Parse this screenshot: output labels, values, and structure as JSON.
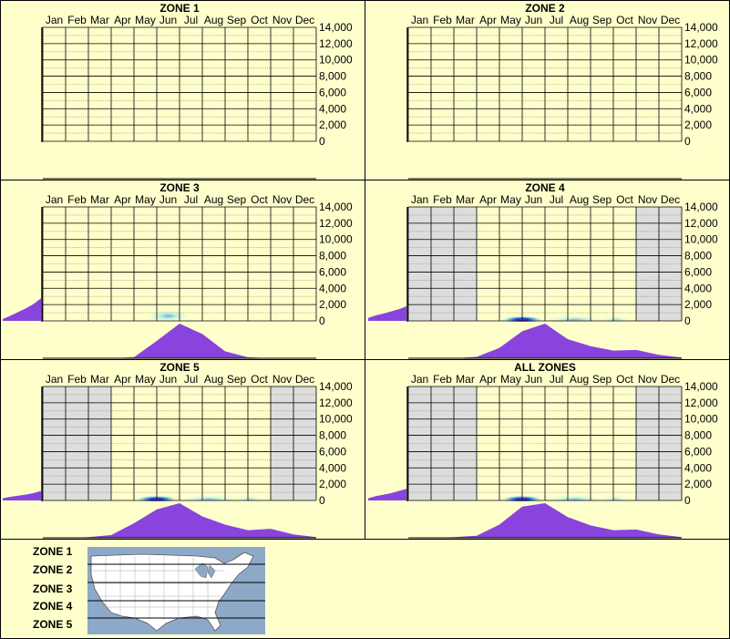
{
  "months": [
    "Jan",
    "Feb",
    "Mar",
    "Apr",
    "May",
    "Jun",
    "Jul",
    "Aug",
    "Sep",
    "Oct",
    "Nov",
    "Dec"
  ],
  "y_ticks": [
    "14,000",
    "12,000",
    "10,000",
    "8,000",
    "6,000",
    "4,000",
    "2,000",
    "0"
  ],
  "colors": {
    "background": "#ffffcc",
    "grid": "#000000",
    "minor_grid": "#888888",
    "off_season": "#dddddd",
    "profile": "#8844dd",
    "heat_center": "#ff2266",
    "heat_core": "#2222cc",
    "heat_mid": "#3399dd",
    "heat_edge": "#aaeeee"
  },
  "chart_data": [
    {
      "type": "heatmap",
      "title": "ZONE 1",
      "x": [
        "Jan",
        "Feb",
        "Mar",
        "Apr",
        "May",
        "Jun",
        "Jul",
        "Aug",
        "Sep",
        "Oct",
        "Nov",
        "Dec"
      ],
      "ylim": [
        0,
        14000
      ],
      "shaded_months": [],
      "heat": [],
      "monthly_profile": [],
      "elevation_profile": []
    },
    {
      "type": "heatmap",
      "title": "ZONE 2",
      "x": [
        "Jan",
        "Feb",
        "Mar",
        "Apr",
        "May",
        "Jun",
        "Jul",
        "Aug",
        "Sep",
        "Oct",
        "Nov",
        "Dec"
      ],
      "ylim": [
        0,
        14000
      ],
      "shaded_months": [],
      "heat": [],
      "monthly_profile": [],
      "elevation_profile": []
    },
    {
      "type": "heatmap",
      "title": "ZONE 3",
      "x": [
        "Jan",
        "Feb",
        "Mar",
        "Apr",
        "May",
        "Jun",
        "Jul",
        "Aug",
        "Sep",
        "Oct",
        "Nov",
        "Dec"
      ],
      "ylim": [
        0,
        14000
      ],
      "shaded_months": [],
      "heat": [
        {
          "month": 6.0,
          "spread": 0.9,
          "elev": 600,
          "elev_spread": 700,
          "intensity": 0.35
        }
      ],
      "monthly_profile": [
        0,
        0,
        0,
        0,
        0.03,
        0.5,
        1.0,
        0.7,
        0.2,
        0.03,
        0,
        0,
        0
      ],
      "elevation_profile": [
        0.05,
        0.14,
        0.24,
        0.34,
        0.46,
        0.62
      ]
    },
    {
      "type": "heatmap",
      "title": "ZONE 4",
      "x": [
        "Jan",
        "Feb",
        "Mar",
        "Apr",
        "May",
        "Jun",
        "Jul",
        "Aug",
        "Sep",
        "Oct",
        "Nov",
        "Dec"
      ],
      "ylim": [
        0,
        14000
      ],
      "shaded_months": [
        "Jan",
        "Feb",
        "Mar",
        "Nov",
        "Dec"
      ],
      "heat": [
        {
          "month": 5.5,
          "spread": 0.9,
          "elev": 150,
          "elev_spread": 250,
          "intensity": 1.0
        },
        {
          "month": 7.8,
          "spread": 1.2,
          "elev": 150,
          "elev_spread": 220,
          "intensity": 0.3
        },
        {
          "month": 9.6,
          "spread": 0.6,
          "elev": 150,
          "elev_spread": 220,
          "intensity": 0.18
        }
      ],
      "monthly_profile": [
        0,
        0,
        0,
        0.04,
        0.3,
        0.78,
        1.0,
        0.55,
        0.35,
        0.22,
        0.24,
        0.1,
        0.02
      ],
      "elevation_profile": [
        0.08,
        0.15,
        0.2,
        0.26,
        0.32,
        0.4
      ]
    },
    {
      "type": "heatmap",
      "title": "ZONE 5",
      "x": [
        "Jan",
        "Feb",
        "Mar",
        "Apr",
        "May",
        "Jun",
        "Jul",
        "Aug",
        "Sep",
        "Oct",
        "Nov",
        "Dec"
      ],
      "ylim": [
        0,
        14000
      ],
      "shaded_months": [
        "Jan",
        "Feb",
        "Mar",
        "Nov",
        "Dec"
      ],
      "heat": [
        {
          "month": 5.5,
          "spread": 0.9,
          "elev": 150,
          "elev_spread": 250,
          "intensity": 1.0
        },
        {
          "month": 7.8,
          "spread": 1.2,
          "elev": 150,
          "elev_spread": 220,
          "intensity": 0.3
        },
        {
          "month": 9.6,
          "spread": 0.6,
          "elev": 150,
          "elev_spread": 220,
          "intensity": 0.18
        }
      ],
      "monthly_profile": [
        0,
        0,
        0.02,
        0.08,
        0.42,
        0.82,
        1.0,
        0.62,
        0.38,
        0.22,
        0.26,
        0.1,
        0.02
      ],
      "elevation_profile": [
        0.06,
        0.1,
        0.13,
        0.16,
        0.2,
        0.26
      ]
    },
    {
      "type": "heatmap",
      "title": "ALL ZONES",
      "x": [
        "Jan",
        "Feb",
        "Mar",
        "Apr",
        "May",
        "Jun",
        "Jul",
        "Aug",
        "Sep",
        "Oct",
        "Nov",
        "Dec"
      ],
      "ylim": [
        0,
        14000
      ],
      "shaded_months": [
        "Jan",
        "Feb",
        "Mar",
        "Nov",
        "Dec"
      ],
      "heat": [
        {
          "month": 5.5,
          "spread": 0.9,
          "elev": 150,
          "elev_spread": 250,
          "intensity": 1.0
        },
        {
          "month": 7.8,
          "spread": 1.2,
          "elev": 150,
          "elev_spread": 220,
          "intensity": 0.3
        },
        {
          "month": 9.6,
          "spread": 0.6,
          "elev": 150,
          "elev_spread": 220,
          "intensity": 0.18
        }
      ],
      "monthly_profile": [
        0,
        0,
        0.02,
        0.06,
        0.38,
        0.9,
        1.0,
        0.6,
        0.36,
        0.22,
        0.24,
        0.1,
        0.02
      ],
      "elevation_profile": [
        0.06,
        0.12,
        0.16,
        0.2,
        0.26,
        0.32
      ]
    }
  ],
  "legend": {
    "zones": [
      "ZONE 1",
      "ZONE 2",
      "ZONE 3",
      "ZONE 4",
      "ZONE 5"
    ],
    "map_icon": "usa-map-icon"
  }
}
